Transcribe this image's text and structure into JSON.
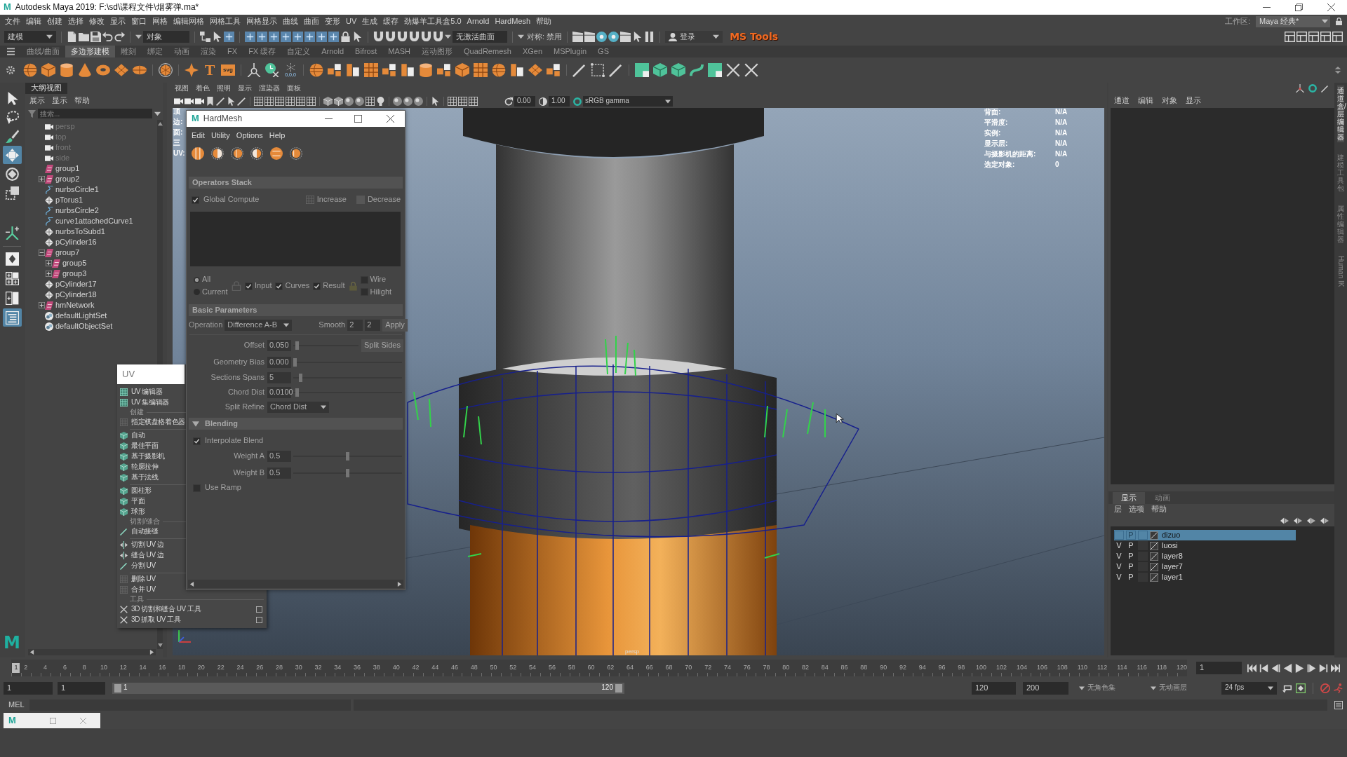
{
  "window": {
    "app_icon": "M",
    "title": "Autodesk Maya 2019: F:\\sd\\课程文件\\烟雾弹.ma*"
  },
  "menu_bar": {
    "items": [
      "文件",
      "编辑",
      "创建",
      "选择",
      "修改",
      "显示",
      "窗口",
      "网格",
      "编辑网格",
      "网格工具",
      "网格显示",
      "曲线",
      "曲面",
      "变形",
      "UV",
      "生成",
      "缓存",
      "劲爆羊工具盒5.0",
      "Arnold",
      "HardMesh",
      "帮助"
    ],
    "workspace_label": "工作区:",
    "workspace": "Maya 经典*"
  },
  "status_line": {
    "mode": "建模",
    "selection_mask": "对象",
    "live_surface": "无激活曲面",
    "symmetry": "对称: 禁用",
    "login": "登录",
    "logo": "MS Tools"
  },
  "shelf": {
    "tabs": [
      {
        "label": "曲线/曲面",
        "selected": false
      },
      {
        "label": "多边形建模",
        "selected": true
      },
      {
        "label": "雕刻",
        "selected": false
      },
      {
        "label": "绑定",
        "selected": false
      },
      {
        "label": "动画",
        "selected": false
      },
      {
        "label": "渲染",
        "selected": false
      },
      {
        "label": "FX",
        "selected": false
      },
      {
        "label": "FX 缓存",
        "selected": false
      },
      {
        "label": "自定义",
        "selected": false
      },
      {
        "label": "Arnold",
        "selected": false
      },
      {
        "label": "Bifrost",
        "selected": false
      },
      {
        "label": "MASH",
        "selected": false
      },
      {
        "label": "运动图形",
        "selected": false
      },
      {
        "label": "QuadRemesh",
        "selected": false
      },
      {
        "label": "XGen",
        "selected": false
      },
      {
        "label": "MSPlugin",
        "selected": false
      },
      {
        "label": "GS",
        "selected": false
      }
    ],
    "type_button": "T",
    "svg_button": "svg",
    "coords_button": "0,0,0"
  },
  "toolbox": {
    "tools": [
      {
        "selected": false
      },
      {
        "selected": false
      },
      {
        "selected": false
      },
      {
        "selected": true
      },
      {
        "selected": false
      },
      {
        "selected": false
      },
      {
        "selected": false
      }
    ],
    "layouts": [
      {
        "selected": false
      },
      {
        "selected": false
      },
      {
        "selected": false
      },
      {
        "selected": true
      }
    ],
    "logo": "M"
  },
  "outliner": {
    "title": "大纲视图",
    "menu": [
      "展示",
      "显示",
      "帮助"
    ],
    "search": {
      "placeholder": "搜索..."
    },
    "items": [
      {
        "label": "persp",
        "kind": "camera",
        "hidden": true,
        "expandable": false
      },
      {
        "label": "top",
        "kind": "camera",
        "hidden": true,
        "expandable": false
      },
      {
        "label": "front",
        "kind": "camera",
        "hidden": true,
        "expandable": false
      },
      {
        "label": "side",
        "kind": "camera",
        "hidden": true,
        "expandable": false
      },
      {
        "label": "group1",
        "kind": "group",
        "hidden": false,
        "expandable": false
      },
      {
        "label": "group2",
        "kind": "group",
        "hidden": false,
        "expandable": true,
        "expanded": false
      },
      {
        "label": "nurbsCircle1",
        "kind": "curve",
        "hidden": false,
        "expandable": false
      },
      {
        "label": "pTorus1",
        "kind": "mesh",
        "hidden": false,
        "expandable": false
      },
      {
        "label": "nurbsCircle2",
        "kind": "curve",
        "hidden": false,
        "expandable": false
      },
      {
        "label": "curve1attachedCurve1",
        "kind": "curve",
        "hidden": false,
        "expandable": false
      },
      {
        "label": "nurbsToSubd1",
        "kind": "mesh",
        "hidden": false,
        "expandable": false
      },
      {
        "label": "pCylinder16",
        "kind": "mesh",
        "hidden": false,
        "expandable": false
      },
      {
        "label": "group7",
        "kind": "group",
        "hidden": false,
        "expandable": true,
        "expanded": true,
        "children": [
          {
            "label": "group5",
            "kind": "group",
            "hidden": false,
            "expandable": true,
            "expanded": false
          },
          {
            "label": "group3",
            "kind": "group",
            "hidden": false,
            "expandable": true,
            "expanded": false
          }
        ]
      },
      {
        "label": "pCylinder17",
        "kind": "mesh",
        "hidden": false,
        "expandable": false
      },
      {
        "label": "pCylinder18",
        "kind": "mesh",
        "hidden": false,
        "expandable": false
      },
      {
        "label": "hmNetwork",
        "kind": "group",
        "hidden": false,
        "expandable": true,
        "expanded": false
      },
      {
        "label": "defaultLightSet",
        "kind": "set",
        "hidden": false,
        "expandable": false
      },
      {
        "label": "defaultObjectSet",
        "kind": "set",
        "hidden": false,
        "expandable": false
      }
    ]
  },
  "viewport": {
    "menu": [
      "视图",
      "着色",
      "照明",
      "显示",
      "渲染器",
      "面板"
    ],
    "exposure": "0.00",
    "gamma": "1.00",
    "color_space": "sRGB gamma",
    "hud_left": [
      "顶",
      "边:",
      "面:",
      "三",
      "UV:"
    ],
    "hud": [
      {
        "label": "背面:",
        "value": "N/A"
      },
      {
        "label": "平滑度:",
        "value": "N/A"
      },
      {
        "label": "实例:",
        "value": "N/A"
      },
      {
        "label": "显示层:",
        "value": "N/A"
      },
      {
        "label": "与摄影机的距离:",
        "value": "N/A"
      },
      {
        "label": "选定对象:",
        "value": "0"
      }
    ],
    "camera": "persp"
  },
  "hardmesh": {
    "icon": "M",
    "title": "HardMesh",
    "menu": [
      "Edit",
      "Utility",
      "Options",
      "Help"
    ],
    "operators_stack": {
      "header": "Operators Stack",
      "global_compute": {
        "label": "Global Compute",
        "checked": true
      },
      "increase": "Increase",
      "decrease": "Decrease",
      "scope": [
        {
          "label": "All",
          "selected": true
        },
        {
          "label": "Current",
          "selected": false
        }
      ],
      "filters": [
        {
          "label": "Input",
          "checked": true
        },
        {
          "label": "Curves",
          "checked": true
        },
        {
          "label": "Result",
          "checked": true
        }
      ],
      "display": [
        {
          "label": "Wire",
          "checked": false
        },
        {
          "label": "Hilight",
          "checked": false
        }
      ]
    },
    "basic_parameters": {
      "header": "Basic Parameters",
      "operation_label": "Operation",
      "operation": "Difference A-B",
      "smooth_label": "Smooth",
      "smooth_values": [
        "2",
        "2"
      ],
      "apply": "Apply",
      "split_sides": "Split Sides",
      "sliders": [
        {
          "label": "Offset",
          "value": "0.050",
          "level": 0.03
        },
        {
          "label": "Geometry Bias",
          "value": "0.000",
          "level": 0.0
        },
        {
          "label": "Sections Spans",
          "value": "5",
          "level": 0.05
        },
        {
          "label": "Chord Dist",
          "value": "0.0100",
          "level": 0.02
        }
      ],
      "split_refine_label": "Split Refine",
      "split_refine": "Chord Dist"
    },
    "blending": {
      "header": "Blending",
      "expanded": true,
      "interpolate": {
        "label": "Interpolate Blend",
        "checked": true
      },
      "weights": [
        {
          "label": "Weight A",
          "value": "0.5",
          "level": 0.5
        },
        {
          "label": "Weight B",
          "value": "0.5",
          "level": 0.5
        }
      ],
      "use_ramp": {
        "label": "Use Ramp",
        "checked": false
      }
    }
  },
  "uv_menu": {
    "title": "UV",
    "entries": [
      {
        "kind": "item",
        "label": "UV 编辑器"
      },
      {
        "kind": "item",
        "label": "UV 集编辑器"
      },
      {
        "kind": "section",
        "label": "创建"
      },
      {
        "kind": "item",
        "label": "指定棋盘格着色器"
      },
      {
        "kind": "separator"
      },
      {
        "kind": "item",
        "label": "自动"
      },
      {
        "kind": "item",
        "label": "最佳平面"
      },
      {
        "kind": "item",
        "label": "基于摄影机"
      },
      {
        "kind": "item",
        "label": "轮廓拉伸"
      },
      {
        "kind": "item",
        "label": "基于法线"
      },
      {
        "kind": "separator"
      },
      {
        "kind": "item",
        "label": "圆柱形"
      },
      {
        "kind": "item",
        "label": "平面"
      },
      {
        "kind": "item",
        "label": "球形"
      },
      {
        "kind": "section",
        "label": "切割/缝合"
      },
      {
        "kind": "item",
        "label": "自动接缝"
      },
      {
        "kind": "separator"
      },
      {
        "kind": "item",
        "label": "切割 UV 边"
      },
      {
        "kind": "item",
        "label": "缝合 UV 边"
      },
      {
        "kind": "item",
        "label": "分割 UV"
      },
      {
        "kind": "separator"
      },
      {
        "kind": "item",
        "label": "删除 UV"
      },
      {
        "kind": "item",
        "label": "合并 UV"
      },
      {
        "kind": "section",
        "label": "工具"
      },
      {
        "kind": "option_item",
        "label": "3D 切割和缝合 UV 工具"
      },
      {
        "kind": "option_item",
        "label": "3D 抓取 UV 工具"
      }
    ]
  },
  "channel_box": {
    "menu": [
      "通道",
      "编辑",
      "对象",
      "显示"
    ]
  },
  "layer_editor": {
    "tabs": [
      {
        "label": "显示",
        "selected": true
      },
      {
        "label": "动画",
        "selected": false
      }
    ],
    "menu": [
      "层",
      "选项",
      "帮助"
    ],
    "layers": [
      {
        "name": "dizuo",
        "selected": true,
        "playback": "P"
      },
      {
        "name": "luosi",
        "selected": false,
        "visibility": "V",
        "playback": "P"
      },
      {
        "name": "layer8",
        "selected": false,
        "visibility": "V",
        "playback": "P"
      },
      {
        "name": "layer7",
        "selected": false,
        "visibility": "V",
        "playback": "P"
      },
      {
        "name": "layer1",
        "selected": false,
        "visibility": "V",
        "playback": "P"
      }
    ]
  },
  "side_tabs": [
    {
      "label": "通道盒/层编辑器",
      "kind": "cjk",
      "selected": true
    },
    {
      "label": "建模工具包",
      "kind": "cjk",
      "selected": false
    },
    {
      "label": "属性编辑器",
      "kind": "cjk",
      "selected": false
    },
    {
      "label": "Human IK",
      "kind": "latin",
      "selected": false
    }
  ],
  "time_slider": {
    "current": "1",
    "labels": [
      "2",
      "4",
      "6",
      "8",
      "10",
      "12",
      "14",
      "16",
      "18",
      "20",
      "22",
      "24",
      "26",
      "28",
      "30",
      "32",
      "34",
      "36",
      "38",
      "40",
      "42",
      "44",
      "46",
      "48",
      "50",
      "52",
      "54",
      "56",
      "58",
      "60",
      "62",
      "64",
      "66",
      "68",
      "70",
      "72",
      "74",
      "76",
      "78",
      "80",
      "82",
      "84",
      "86",
      "88",
      "90",
      "92",
      "94",
      "96",
      "98",
      "100",
      "102",
      "104",
      "106",
      "108",
      "110",
      "112",
      "114",
      "116",
      "118",
      "120"
    ],
    "frame": "1"
  },
  "range_slider": {
    "start": "1",
    "playback_start": "1",
    "handle_start": "1",
    "handle_end": "120",
    "playback_end": "120",
    "end": "200",
    "character_set": "无角色集",
    "anim_layer": "无动画层",
    "fps": "24 fps"
  },
  "command_line": {
    "language": "MEL"
  },
  "minimized_window": {
    "icon": "M"
  }
}
